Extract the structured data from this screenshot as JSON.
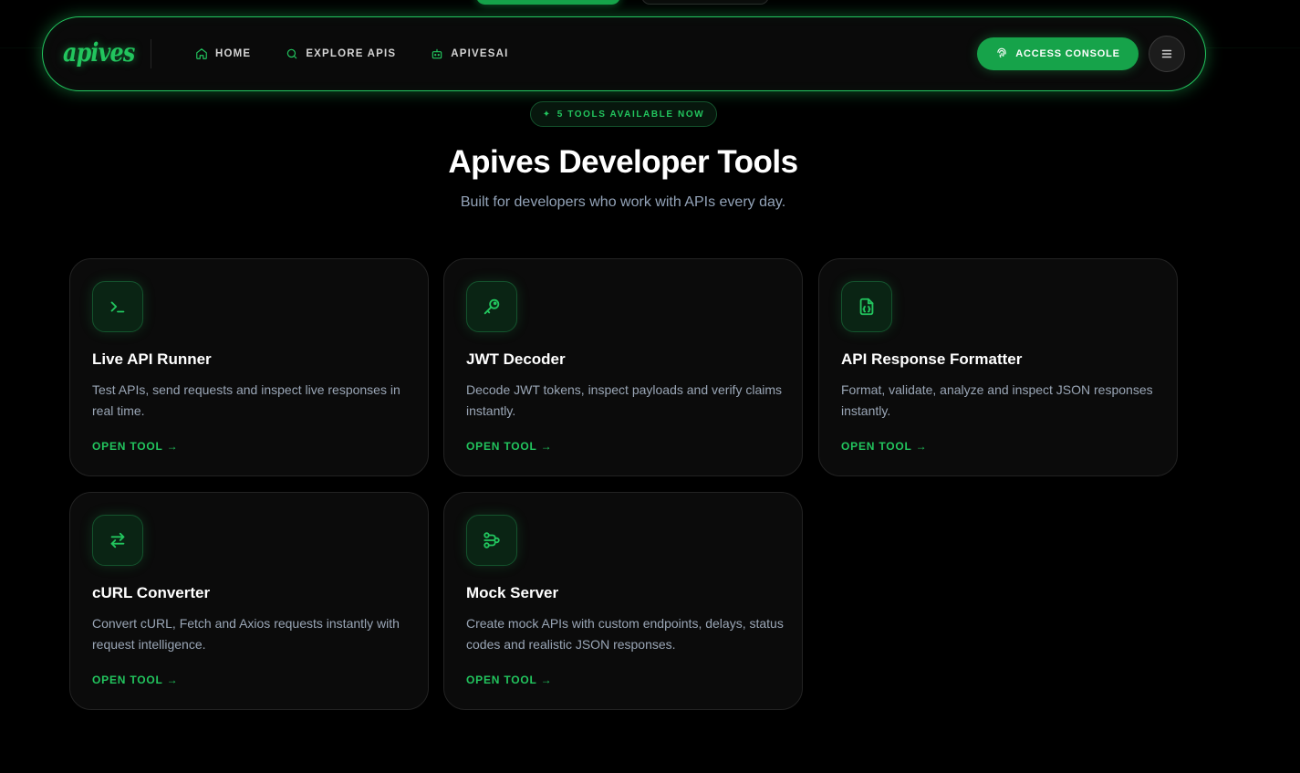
{
  "nav": {
    "logo": "apives",
    "links": [
      {
        "label": "HOME",
        "icon": "home-icon"
      },
      {
        "label": "EXPLORE APIS",
        "icon": "search-icon"
      },
      {
        "label": "APIVESAI",
        "icon": "robot-icon"
      }
    ],
    "console_label": "ACCESS CONSOLE",
    "console_icon": "fingerprint-icon",
    "menu_icon": "hamburger-icon"
  },
  "hero": {
    "badge": "5 TOOLS AVAILABLE NOW",
    "title": "Apives Developer Tools",
    "subtitle": "Built for developers who work with APIs every day."
  },
  "tools": [
    {
      "title": "Live API Runner",
      "desc": "Test APIs, send requests and inspect live responses in real time.",
      "cta": "OPEN TOOL →",
      "icon": "terminal-icon"
    },
    {
      "title": "JWT Decoder",
      "desc": "Decode JWT tokens, inspect payloads and verify claims instantly.",
      "cta": "OPEN TOOL →",
      "icon": "key-icon"
    },
    {
      "title": "API Response Formatter",
      "desc": "Format, validate, analyze and inspect JSON responses instantly.",
      "cta": "OPEN TOOL →",
      "icon": "json-file-icon"
    },
    {
      "title": "cURL Converter",
      "desc": "Convert cURL, Fetch and Axios requests instantly with request intelligence.",
      "cta": "OPEN TOOL →",
      "icon": "swap-arrows-icon"
    },
    {
      "title": "Mock Server",
      "desc": "Create mock APIs with custom endpoints, delays, status codes and realistic JSON responses.",
      "cta": "OPEN TOOL →",
      "icon": "workflow-icon"
    }
  ],
  "colors": {
    "accent": "#22c55e",
    "accent_dark": "#16a34a",
    "background": "#000000",
    "card": "#0b0b0b",
    "muted_text": "#9aa6b6"
  }
}
